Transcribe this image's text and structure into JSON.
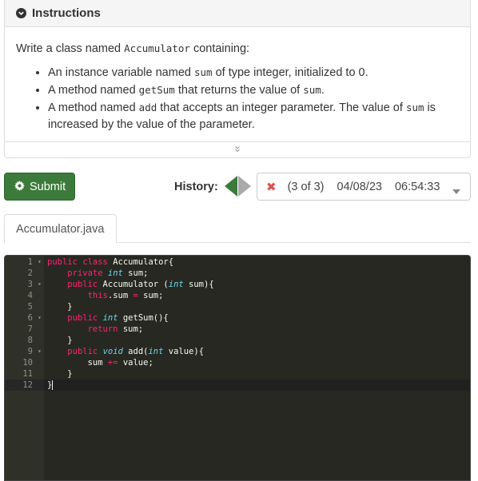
{
  "instructions": {
    "title": "Instructions",
    "intro_prefix": "Write a class named ",
    "intro_code": "Accumulator",
    "intro_suffix": " containing:",
    "bullets": [
      {
        "p1": "An instance variable named ",
        "c1": "sum",
        "p2": " of type integer, initialized to 0."
      },
      {
        "p1": "A method named ",
        "c1": "getSum",
        "p2": " that returns the value of ",
        "c2": "sum",
        "p3": "."
      },
      {
        "p1": "A method named ",
        "c1": "add",
        "p2": " that accepts an integer parameter. The value of ",
        "c2": "sum",
        "p3": " is increased by the value of the parameter."
      }
    ]
  },
  "toolbar": {
    "submit_label": "Submit",
    "history_label": "History:",
    "history_selected": {
      "count": "(3 of 3)",
      "date": "04/08/23",
      "time": "06:54:33"
    }
  },
  "tabs": [
    {
      "label": "Accumulator.java"
    }
  ],
  "editor": {
    "lines": [
      "1",
      "2",
      "3",
      "4",
      "5",
      "6",
      "7",
      "8",
      "9",
      "10",
      "11",
      "12"
    ]
  },
  "colors": {
    "submit_bg": "#3b7a3b",
    "editor_bg": "#272822",
    "keyword": "#f92672",
    "type": "#66d9ef",
    "error_x": "#d9534f"
  }
}
